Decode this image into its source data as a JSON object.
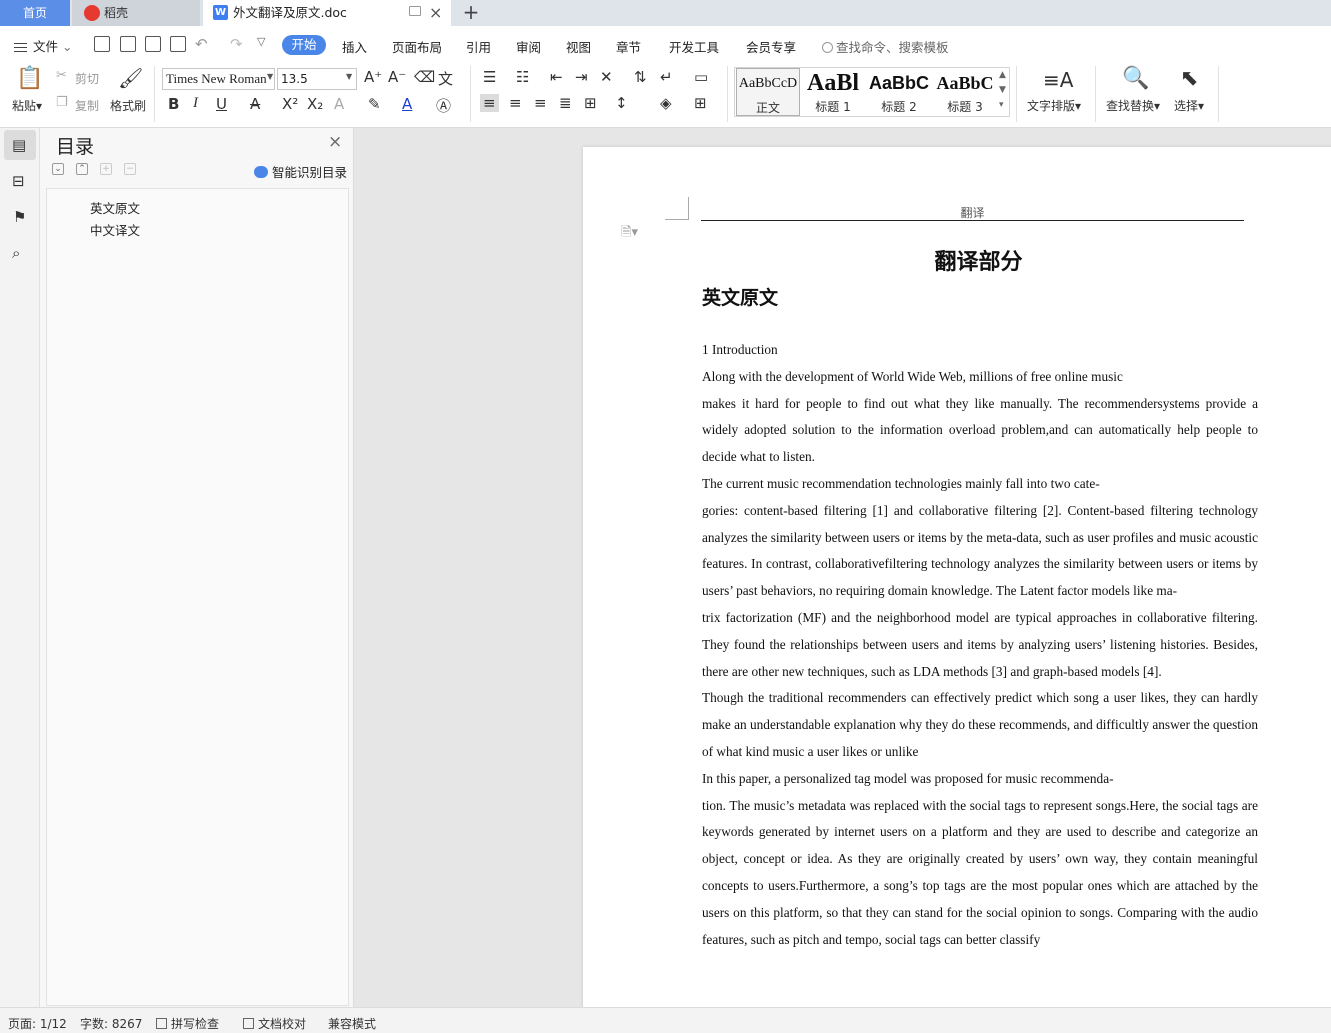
{
  "tabs": {
    "home": "首页",
    "daoke": "稻壳",
    "doc": "外文翻译及原文.doc"
  },
  "menu": {
    "file": "文件",
    "items": [
      "开始",
      "插入",
      "页面布局",
      "引用",
      "审阅",
      "视图",
      "章节",
      "开发工具",
      "会员专享"
    ],
    "search": "查找命令、搜索模板"
  },
  "ribbon": {
    "paste": "粘贴",
    "cut": "剪切",
    "copy": "复制",
    "format_painter": "格式刷",
    "font_name": "Times New Roman",
    "font_size": "13.5",
    "styles": [
      {
        "sample": "AaBbCcD",
        "label": "正文"
      },
      {
        "sample": "AaBl",
        "label": "标题 1"
      },
      {
        "sample": "AaBbC",
        "label": "标题 2"
      },
      {
        "sample": "AaBbC",
        "label": "标题 3"
      }
    ],
    "text_layout": "文字排版",
    "find_replace": "查找替换",
    "select": "选择"
  },
  "toc": {
    "title": "目录",
    "smart": "智能识别目录",
    "items": [
      "英文原文",
      "中文译文"
    ]
  },
  "document": {
    "header": "翻译",
    "title": "翻译部分",
    "heading": "英文原文",
    "paragraphs": [
      "1 Introduction",
      "Along with the development of World Wide Web, millions of free online music",
      "makes it hard for people to find out what they like manually. The recommendersystems provide a widely adopted solution to the information overload problem,and can automatically help people to decide what to listen.",
      "The current music recommendation technologies mainly fall into two cate-",
      "gories: content-based filtering [1] and collaborative filtering [2]. Content-based filtering technology analyzes the similarity between users or items by the meta-data, such as user profiles and music acoustic features. In contrast, collaborativefiltering technology analyzes the similarity between users or items by users’ past behaviors, no requiring domain knowledge. The Latent factor models like ma-",
      "trix factorization (MF) and the neighborhood model are typical approaches in collaborative filtering. They found the relationships between users and items by analyzing users’ listening histories. Besides, there are other new techniques, such as LDA methods [3] and graph-based models [4].",
      "Though the traditional recommenders can effectively predict which song a user likes, they can hardly make an understandable explanation why they do these recommends, and difficultly answer the question of what kind music a user likes or unlike",
      "In this paper, a personalized tag model was proposed for music recommenda-",
      "tion. The music’s metadata was replaced with the social tags to represent songs.Here, the social tags are keywords generated by internet users on a platform and they are used to describe and categorize an object, concept or idea. As they are originally created by users’ own way, they contain meaningful concepts to users.Furthermore, a song’s top tags are the most popular ones which are attached by the users on this platform, so that they can stand for the social opinion to songs. Comparing with the audio features, such as pitch and tempo, social tags can better classify"
    ]
  },
  "status": {
    "page": "页面: 1/12",
    "words": "字数: 8267",
    "spell": "拼写检查",
    "proof": "文档校对",
    "compat": "兼容模式"
  }
}
